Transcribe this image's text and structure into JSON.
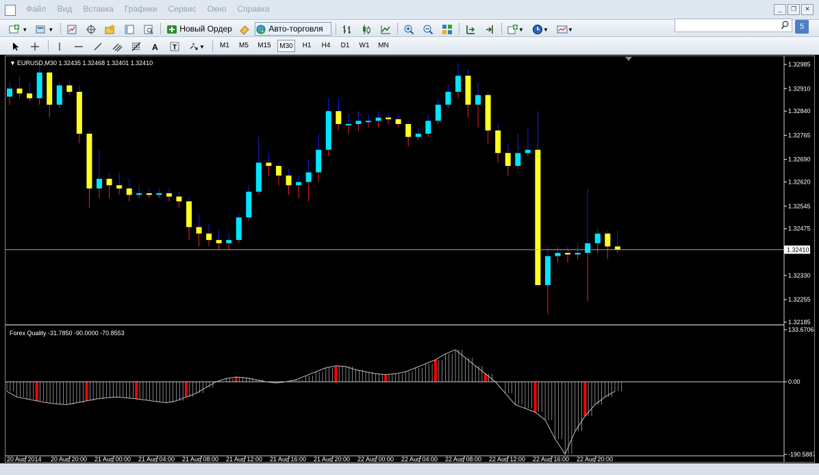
{
  "menu": {
    "items": [
      "Файл",
      "Вид",
      "Вставка",
      "Графики",
      "Сервис",
      "Окно",
      "Справка"
    ]
  },
  "toolbar": {
    "new_order_label": "Новый Ордер",
    "auto_trading_label": "Авто-торговля",
    "timeframes": [
      "M1",
      "M5",
      "M15",
      "M30",
      "H1",
      "H4",
      "D1",
      "W1",
      "MN"
    ],
    "active_timeframe": "M30"
  },
  "search": {
    "value": ""
  },
  "help_badge": "5",
  "chart": {
    "header": "EURUSD,M30  1.32435 1.32468 1.32401 1.32410",
    "price_axis": [
      "1.32985",
      "1.32910",
      "1.32840",
      "1.32765",
      "1.32690",
      "1.32620",
      "1.32545",
      "1.32475",
      "1.32410",
      "1.32330",
      "1.32255",
      "1.32185"
    ],
    "current_price": "1.32410",
    "time_axis": [
      "20 Aug 2014",
      "20 Aug 20:00",
      "21 Aug 00:00",
      "21 Aug 04:00",
      "21 Aug 08:00",
      "21 Aug 12:00",
      "21 Aug 16:00",
      "21 Aug 20:00",
      "22 Aug 00:00",
      "22 Aug 04:00",
      "22 Aug 08:00",
      "22 Aug 12:00",
      "22 Aug 16:00",
      "22 Aug 20:00"
    ],
    "colors": {
      "bull": "#00e5ff",
      "bear": "#ffff22",
      "wick_up": "#1a1aff",
      "wick_down": "#ff2020",
      "axis": "#ffffff",
      "indicator_bar": "#ff0000",
      "indicator_line": "#c0c0c0"
    }
  },
  "indicator": {
    "header": "Forex Quality -31.7850 -90.0000 -70.8553",
    "axis": [
      "133.6706",
      "0.00",
      "-190.5887"
    ]
  },
  "chart_data": {
    "type": "candlestick",
    "series": [
      {
        "name": "EURUSD,M30",
        "values": [
          [
            1.32885,
            1.3293,
            1.3286,
            1.3291
          ],
          [
            1.3291,
            1.3295,
            1.3288,
            1.32895
          ],
          [
            1.32895,
            1.3293,
            1.3287,
            1.3288
          ],
          [
            1.3288,
            1.3299,
            1.3286,
            1.3296
          ],
          [
            1.3296,
            1.3297,
            1.3282,
            1.3286
          ],
          [
            1.3286,
            1.3293,
            1.3285,
            1.3292
          ],
          [
            1.3292,
            1.3294,
            1.3289,
            1.329
          ],
          [
            1.329,
            1.3292,
            1.3274,
            1.3277
          ],
          [
            1.3277,
            1.3278,
            1.3254,
            1.326
          ],
          [
            1.326,
            1.3272,
            1.3257,
            1.3263
          ],
          [
            1.3263,
            1.3265,
            1.3257,
            1.3261
          ],
          [
            1.3261,
            1.3265,
            1.3258,
            1.326
          ],
          [
            1.326,
            1.3263,
            1.3256,
            1.3258
          ],
          [
            1.3258,
            1.3261,
            1.3257,
            1.32585
          ],
          [
            1.32585,
            1.326,
            1.3257,
            1.3258
          ],
          [
            1.3258,
            1.326,
            1.3257,
            1.32585
          ],
          [
            1.32585,
            1.326,
            1.3256,
            1.32575
          ],
          [
            1.32575,
            1.3259,
            1.3254,
            1.3256
          ],
          [
            1.3256,
            1.3257,
            1.3244,
            1.3248
          ],
          [
            1.3248,
            1.3252,
            1.3242,
            1.3246
          ],
          [
            1.3246,
            1.3249,
            1.3242,
            1.3244
          ],
          [
            1.3244,
            1.3247,
            1.3241,
            1.3243
          ],
          [
            1.3243,
            1.3246,
            1.3241,
            1.3244
          ],
          [
            1.3244,
            1.3252,
            1.3243,
            1.3251
          ],
          [
            1.3251,
            1.3261,
            1.325,
            1.3259
          ],
          [
            1.3259,
            1.3276,
            1.3258,
            1.3268
          ],
          [
            1.3268,
            1.3271,
            1.3264,
            1.3267
          ],
          [
            1.3267,
            1.3268,
            1.3261,
            1.3264
          ],
          [
            1.3264,
            1.3266,
            1.3258,
            1.3261
          ],
          [
            1.3261,
            1.3264,
            1.3257,
            1.3262
          ],
          [
            1.3262,
            1.3269,
            1.3256,
            1.3265
          ],
          [
            1.3265,
            1.3277,
            1.3262,
            1.3272
          ],
          [
            1.3272,
            1.3288,
            1.327,
            1.3284
          ],
          [
            1.3284,
            1.3288,
            1.3278,
            1.328
          ],
          [
            1.328,
            1.3283,
            1.3277,
            1.328
          ],
          [
            1.328,
            1.3284,
            1.3278,
            1.3281
          ],
          [
            1.3281,
            1.3283,
            1.3279,
            1.3281
          ],
          [
            1.3281,
            1.3284,
            1.3279,
            1.3282
          ],
          [
            1.3282,
            1.3283,
            1.328,
            1.32815
          ],
          [
            1.32815,
            1.3283,
            1.3279,
            1.328
          ],
          [
            1.328,
            1.3281,
            1.3273,
            1.3276
          ],
          [
            1.3276,
            1.3279,
            1.3275,
            1.3277
          ],
          [
            1.3277,
            1.3283,
            1.3276,
            1.3281
          ],
          [
            1.3281,
            1.3288,
            1.328,
            1.3286
          ],
          [
            1.3286,
            1.3292,
            1.3285,
            1.329
          ],
          [
            1.329,
            1.3299,
            1.3288,
            1.3295
          ],
          [
            1.3295,
            1.3297,
            1.3282,
            1.3286
          ],
          [
            1.3286,
            1.3293,
            1.3279,
            1.3289
          ],
          [
            1.3289,
            1.329,
            1.3274,
            1.3278
          ],
          [
            1.3278,
            1.328,
            1.3268,
            1.3271
          ],
          [
            1.3271,
            1.3274,
            1.3264,
            1.3267
          ],
          [
            1.3267,
            1.3277,
            1.3266,
            1.3271
          ],
          [
            1.3271,
            1.3279,
            1.327,
            1.3272
          ],
          [
            1.3272,
            1.3284,
            1.325,
            1.323
          ],
          [
            1.323,
            1.3242,
            1.3221,
            1.3239
          ],
          [
            1.3239,
            1.3242,
            1.3237,
            1.324
          ],
          [
            1.324,
            1.3242,
            1.3237,
            1.32395
          ],
          [
            1.32395,
            1.3243,
            1.3238,
            1.324
          ],
          [
            1.324,
            1.326,
            1.3225,
            1.3243
          ],
          [
            1.3243,
            1.3248,
            1.324,
            1.3246
          ],
          [
            1.3246,
            1.3247,
            1.3238,
            1.3242
          ],
          [
            1.3242,
            1.3247,
            1.324,
            1.3241
          ]
        ]
      }
    ],
    "indicator_values": [
      -25,
      -40,
      -45,
      -50,
      -55,
      -58,
      -60,
      -55,
      -50,
      -45,
      -42,
      -40,
      -42,
      -45,
      -48,
      -52,
      -55,
      -50,
      -40,
      -30,
      -15,
      0,
      8,
      12,
      10,
      5,
      0,
      -3,
      0,
      5,
      15,
      25,
      35,
      40,
      38,
      30,
      25,
      20,
      18,
      20,
      25,
      35,
      45,
      55,
      70,
      80,
      60,
      40,
      20,
      0,
      -30,
      -60,
      -70,
      -80,
      -100,
      -150,
      -190,
      -130,
      -90,
      -60,
      -40,
      -25
    ],
    "indicator_range": [
      -190.5887,
      133.6706
    ],
    "price_range": [
      1.32185,
      1.32985
    ]
  }
}
